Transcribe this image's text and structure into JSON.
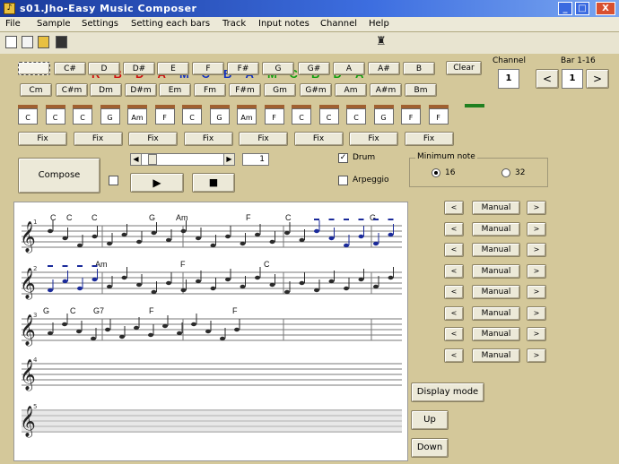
{
  "window": {
    "title": "s01.Jho-Easy Music Composer",
    "controls": {
      "minimize": "_",
      "maximize": "□",
      "close": "X"
    }
  },
  "menu": [
    "File",
    "Sample",
    "Settings",
    "Setting each bars",
    "Track",
    "Input notes",
    "Channel",
    "Help"
  ],
  "toolbar_letters": [
    {
      "t": "R",
      "color": "#d01010"
    },
    {
      "t": "B",
      "color": "#d01010"
    },
    {
      "t": "D",
      "color": "#d01010"
    },
    {
      "t": "A",
      "color": "#d01010"
    },
    {
      "t": "M",
      "color": "#1030c0"
    },
    {
      "t": "C",
      "color": "#1030c0"
    },
    {
      "t": "B",
      "color": "#1030c0"
    },
    {
      "t": "A",
      "color": "#1030c0"
    },
    {
      "t": "M",
      "color": "#10a010"
    },
    {
      "t": "C",
      "color": "#10a010"
    },
    {
      "t": "B",
      "color": "#10a010"
    },
    {
      "t": "D",
      "color": "#10a010"
    },
    {
      "t": "A",
      "color": "#10a010"
    }
  ],
  "key_row1": [
    "",
    "C#",
    "D",
    "D#",
    "E",
    "F",
    "F#",
    "G",
    "G#",
    "A",
    "A#",
    "B"
  ],
  "key_row2": [
    "Cm",
    "C#m",
    "Dm",
    "D#m",
    "Em",
    "Fm",
    "F#m",
    "Gm",
    "G#m",
    "Am",
    "A#m",
    "Bm"
  ],
  "clear_label": "Clear",
  "channel": {
    "label": "Channel",
    "value": "1"
  },
  "bar": {
    "label": "Bar 1-16",
    "value": "1",
    "prev": "<",
    "next": ">"
  },
  "chord_fields": [
    "C",
    "C",
    "C",
    "G",
    "Am",
    "F",
    "C",
    "G",
    "Am",
    "F",
    "C",
    "C",
    "C",
    "G",
    "F",
    "F"
  ],
  "fix_label": "Fix",
  "compose_label": "Compose",
  "play_icon": "▶",
  "stop_icon": "■",
  "tempo_value": "1",
  "drum_label": "Drum",
  "drum_checked": true,
  "arpeggio_label": "Arpeggio",
  "min_note": {
    "label": "Minimum note",
    "options": [
      "16",
      "32"
    ],
    "selected": "16"
  },
  "manual_label": "Manual",
  "arrow_left": "<",
  "arrow_right": ">",
  "display_mode_label": "Display mode",
  "up_label": "Up",
  "down_label": "Down",
  "score_rows": [
    {
      "chords": [
        "C",
        "C",
        "C",
        "G",
        "Am",
        "F",
        "C",
        "G"
      ]
    },
    {
      "chords": [
        "Am",
        "F",
        "C"
      ]
    },
    {
      "chords": [
        "G",
        "C",
        "G7",
        "F",
        "F"
      ]
    },
    {
      "chords": []
    },
    {
      "chords": []
    }
  ]
}
